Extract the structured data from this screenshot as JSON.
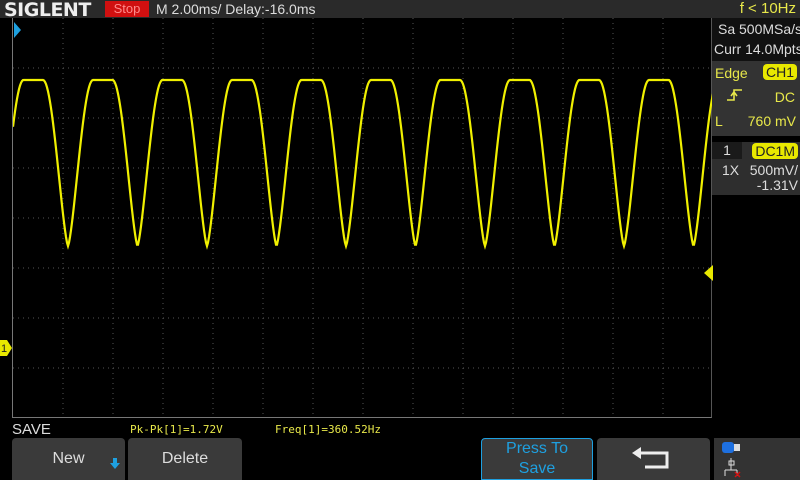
{
  "header": {
    "brand": "SIGLENT",
    "run_state": "Stop",
    "timebase": "M 2.00ms/ Delay:-16.0ms",
    "freq_counter": "f < 10Hz"
  },
  "acquisition": {
    "sample_rate": "Sa 500MSa/s",
    "memory": "Curr 14.0Mpts"
  },
  "trigger": {
    "type": "Edge",
    "source": "CH1",
    "slope_icon": "rising-edge-icon",
    "coupling": "DC",
    "level_label": "L",
    "level": "760 mV"
  },
  "channel1": {
    "number": "1",
    "coupling": "DC1M",
    "probe": "1X",
    "scale": "500mV/",
    "offset": "-1.31V",
    "color": "#f0f000"
  },
  "menu": {
    "title": "SAVE",
    "buttons": [
      "New",
      "Delete",
      "Press To Save"
    ],
    "back_icon": "return-arrow-icon"
  },
  "measurements": [
    "Pk-Pk[1]=1.72V",
    "Freq[1]=360.52Hz"
  ],
  "colors": {
    "trace": "#f0f000",
    "accent": "#1ea0e0",
    "stop": "#d01010"
  }
}
